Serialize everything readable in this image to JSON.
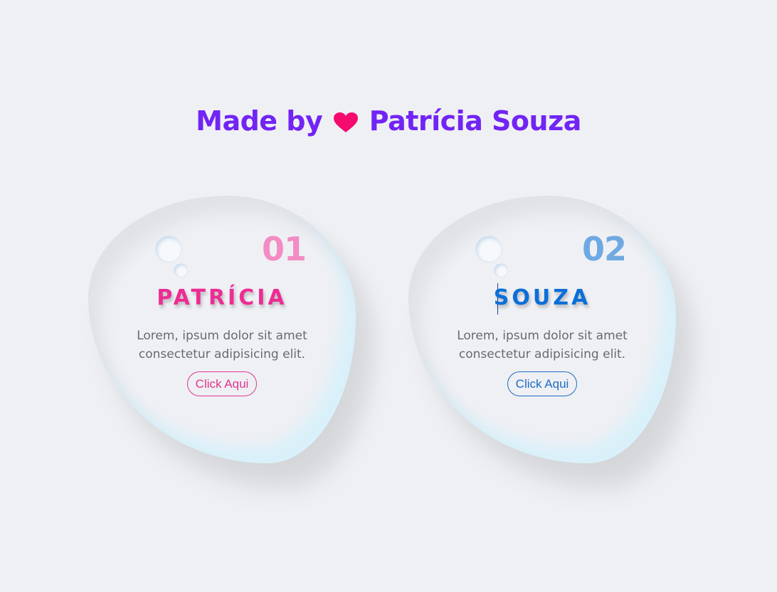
{
  "header": {
    "prefix": "Made by",
    "heart_icon": "heart-icon",
    "author": "Patrícia Souza",
    "color": "#7124f5",
    "heart_color": "#f50a6e"
  },
  "cards": [
    {
      "number": "01",
      "title": "PATRÍCIA",
      "description": "Lorem, ipsum dolor sit amet consectetur adipisicing elit.",
      "button_label": "Click Aqui",
      "accent": "#ee2c93"
    },
    {
      "number": "02",
      "title": "SOUZA",
      "description": "Lorem, ipsum dolor sit amet consectetur adipisicing elit.",
      "button_label": "Click Aqui",
      "accent": "#0b6fd8"
    }
  ]
}
